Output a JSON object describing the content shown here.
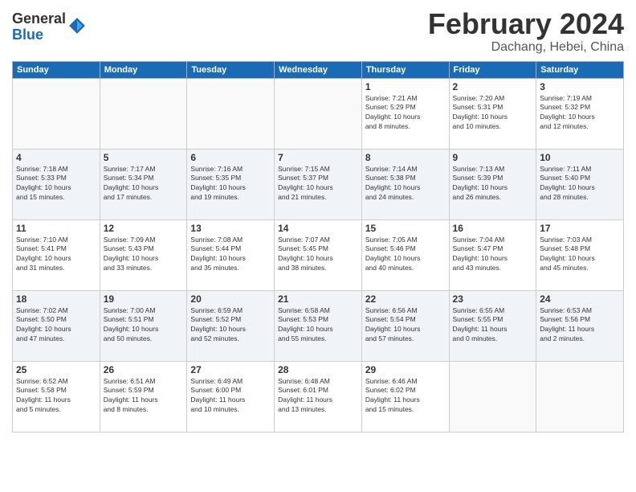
{
  "logo": {
    "general": "General",
    "blue": "Blue"
  },
  "title": "February 2024",
  "location": "Dachang, Hebei, China",
  "weekdays": [
    "Sunday",
    "Monday",
    "Tuesday",
    "Wednesday",
    "Thursday",
    "Friday",
    "Saturday"
  ],
  "weeks": [
    [
      {
        "day": "",
        "info": ""
      },
      {
        "day": "",
        "info": ""
      },
      {
        "day": "",
        "info": ""
      },
      {
        "day": "",
        "info": ""
      },
      {
        "day": "1",
        "info": "Sunrise: 7:21 AM\nSunset: 5:29 PM\nDaylight: 10 hours\nand 8 minutes."
      },
      {
        "day": "2",
        "info": "Sunrise: 7:20 AM\nSunset: 5:31 PM\nDaylight: 10 hours\nand 10 minutes."
      },
      {
        "day": "3",
        "info": "Sunrise: 7:19 AM\nSunset: 5:32 PM\nDaylight: 10 hours\nand 12 minutes."
      }
    ],
    [
      {
        "day": "4",
        "info": "Sunrise: 7:18 AM\nSunset: 5:33 PM\nDaylight: 10 hours\nand 15 minutes."
      },
      {
        "day": "5",
        "info": "Sunrise: 7:17 AM\nSunset: 5:34 PM\nDaylight: 10 hours\nand 17 minutes."
      },
      {
        "day": "6",
        "info": "Sunrise: 7:16 AM\nSunset: 5:35 PM\nDaylight: 10 hours\nand 19 minutes."
      },
      {
        "day": "7",
        "info": "Sunrise: 7:15 AM\nSunset: 5:37 PM\nDaylight: 10 hours\nand 21 minutes."
      },
      {
        "day": "8",
        "info": "Sunrise: 7:14 AM\nSunset: 5:38 PM\nDaylight: 10 hours\nand 24 minutes."
      },
      {
        "day": "9",
        "info": "Sunrise: 7:13 AM\nSunset: 5:39 PM\nDaylight: 10 hours\nand 26 minutes."
      },
      {
        "day": "10",
        "info": "Sunrise: 7:11 AM\nSunset: 5:40 PM\nDaylight: 10 hours\nand 28 minutes."
      }
    ],
    [
      {
        "day": "11",
        "info": "Sunrise: 7:10 AM\nSunset: 5:41 PM\nDaylight: 10 hours\nand 31 minutes."
      },
      {
        "day": "12",
        "info": "Sunrise: 7:09 AM\nSunset: 5:43 PM\nDaylight: 10 hours\nand 33 minutes."
      },
      {
        "day": "13",
        "info": "Sunrise: 7:08 AM\nSunset: 5:44 PM\nDaylight: 10 hours\nand 35 minutes."
      },
      {
        "day": "14",
        "info": "Sunrise: 7:07 AM\nSunset: 5:45 PM\nDaylight: 10 hours\nand 38 minutes."
      },
      {
        "day": "15",
        "info": "Sunrise: 7:05 AM\nSunset: 5:46 PM\nDaylight: 10 hours\nand 40 minutes."
      },
      {
        "day": "16",
        "info": "Sunrise: 7:04 AM\nSunset: 5:47 PM\nDaylight: 10 hours\nand 43 minutes."
      },
      {
        "day": "17",
        "info": "Sunrise: 7:03 AM\nSunset: 5:48 PM\nDaylight: 10 hours\nand 45 minutes."
      }
    ],
    [
      {
        "day": "18",
        "info": "Sunrise: 7:02 AM\nSunset: 5:50 PM\nDaylight: 10 hours\nand 47 minutes."
      },
      {
        "day": "19",
        "info": "Sunrise: 7:00 AM\nSunset: 5:51 PM\nDaylight: 10 hours\nand 50 minutes."
      },
      {
        "day": "20",
        "info": "Sunrise: 6:59 AM\nSunset: 5:52 PM\nDaylight: 10 hours\nand 52 minutes."
      },
      {
        "day": "21",
        "info": "Sunrise: 6:58 AM\nSunset: 5:53 PM\nDaylight: 10 hours\nand 55 minutes."
      },
      {
        "day": "22",
        "info": "Sunrise: 6:56 AM\nSunset: 5:54 PM\nDaylight: 10 hours\nand 57 minutes."
      },
      {
        "day": "23",
        "info": "Sunrise: 6:55 AM\nSunset: 5:55 PM\nDaylight: 11 hours\nand 0 minutes."
      },
      {
        "day": "24",
        "info": "Sunrise: 6:53 AM\nSunset: 5:56 PM\nDaylight: 11 hours\nand 2 minutes."
      }
    ],
    [
      {
        "day": "25",
        "info": "Sunrise: 6:52 AM\nSunset: 5:58 PM\nDaylight: 11 hours\nand 5 minutes."
      },
      {
        "day": "26",
        "info": "Sunrise: 6:51 AM\nSunset: 5:59 PM\nDaylight: 11 hours\nand 8 minutes."
      },
      {
        "day": "27",
        "info": "Sunrise: 6:49 AM\nSunset: 6:00 PM\nDaylight: 11 hours\nand 10 minutes."
      },
      {
        "day": "28",
        "info": "Sunrise: 6:48 AM\nSunset: 6:01 PM\nDaylight: 11 hours\nand 13 minutes."
      },
      {
        "day": "29",
        "info": "Sunrise: 6:46 AM\nSunset: 6:02 PM\nDaylight: 11 hours\nand 15 minutes."
      },
      {
        "day": "",
        "info": ""
      },
      {
        "day": "",
        "info": ""
      }
    ]
  ]
}
